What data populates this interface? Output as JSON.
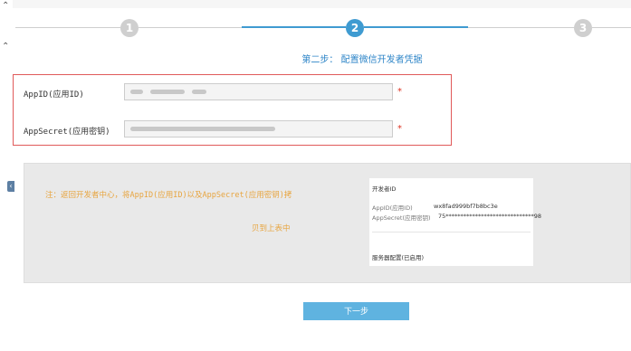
{
  "steps": [
    {
      "number": "1",
      "state": "done"
    },
    {
      "number": "2",
      "state": "active"
    },
    {
      "number": "3",
      "state": "todo"
    }
  ],
  "step_title": "第二步： 配置微信开发者凭据",
  "form": {
    "appid_label": "AppID(应用ID)",
    "appid_value": "",
    "appsecret_label": "AppSecret(应用密钥)",
    "appsecret_value": "",
    "required_mark": "*"
  },
  "note": {
    "line1": "注：返回开发者中心，将AppID(应用ID)以及AppSecret(应用密钥)拷",
    "line2": "贝到上表中"
  },
  "developer_card": {
    "title": "开发者ID",
    "appid_key": "AppID(应用ID)",
    "appid_val": "wx8fad999bf7b8bc3e",
    "secret_key": "AppSecret(应用密钥)",
    "secret_val": "75******************************98",
    "server_config": "服务器配置(已启用)"
  },
  "next_button": "下一步",
  "colors": {
    "accent": "#3f9bd1",
    "inactive": "#cfcfcf",
    "error_border": "#e05a5a",
    "note_text": "#e8a540",
    "button": "#5fb3e0"
  },
  "icons": {
    "chevron_up": "chevron-up-icon",
    "side_tab": "side-collapse-icon"
  }
}
